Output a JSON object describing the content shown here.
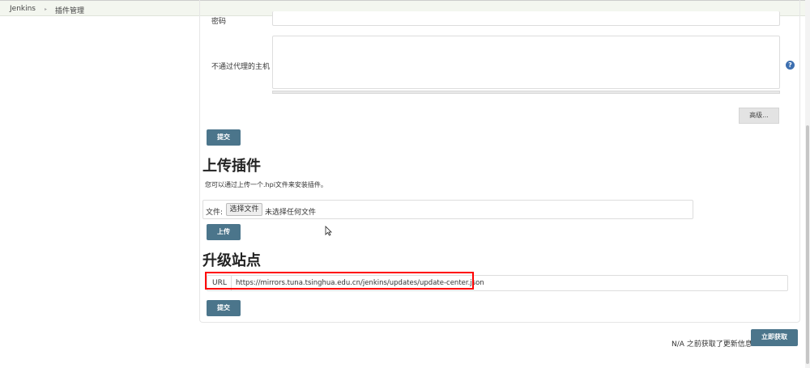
{
  "breadcrumb": {
    "home": "Jenkins",
    "separator": "▸",
    "current": "插件管理"
  },
  "proxy": {
    "password_label": "密码",
    "no_proxy_label": "不通过代理的主机",
    "advanced_button": "高级...",
    "submit_button": "提交"
  },
  "upload": {
    "title": "上传插件",
    "description": "您可以通过上传一个.hpi文件来安装插件。",
    "file_label": "文件:",
    "choose_button": "选择文件",
    "no_file_text": "未选择任何文件",
    "upload_button": "上传"
  },
  "update_site": {
    "title": "升级站点",
    "url_label": "URL",
    "url_value": "https://mirrors.tuna.tsinghua.edu.cn/jenkins/updates/update-center.json",
    "submit_button": "提交"
  },
  "footer": {
    "status_text": "N/A 之前获取了更新信息",
    "check_now_button": "立即获取"
  },
  "colors": {
    "primary_button": "#4b758b",
    "highlight": "#ff0000"
  }
}
